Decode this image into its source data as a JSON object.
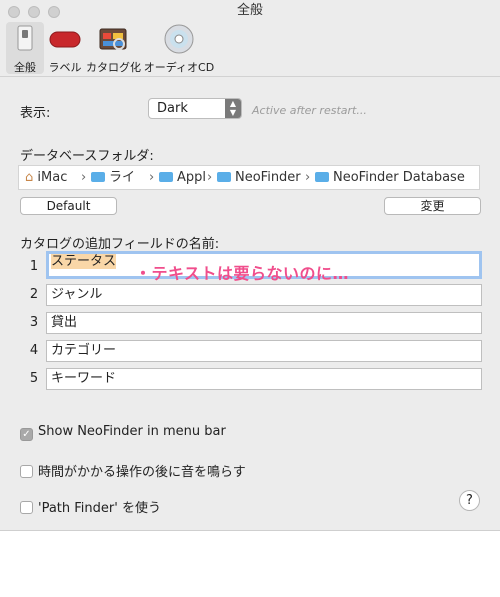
{
  "window": {
    "title": "全般"
  },
  "toolbar": {
    "items": [
      {
        "label": "全般",
        "icon": "general-switch-icon",
        "selected": true
      },
      {
        "label": "ラベル",
        "icon": "label-icon"
      },
      {
        "label": "カタログ化",
        "icon": "catalog-icon"
      },
      {
        "label": "オーディオCD",
        "icon": "audio-cd-icon"
      }
    ]
  },
  "display": {
    "label": "表示:",
    "selected": "Dark",
    "hint": "Active after restart..."
  },
  "database_folder": {
    "label": "データベースフォルダ:",
    "path": [
      "iMac",
      "ライ",
      "Appl",
      "NeoFinder",
      "NeoFinder Database"
    ],
    "default_label": "Default",
    "change_label": "変更"
  },
  "catalog_fields": {
    "label": "カタログの追加フィールドの名前:",
    "fields": [
      {
        "num": "1",
        "value": "ステータス"
      },
      {
        "num": "2",
        "value": "ジャンル"
      },
      {
        "num": "3",
        "value": "貸出"
      },
      {
        "num": "4",
        "value": "カテゴリー"
      },
      {
        "num": "5",
        "value": "キーワード"
      }
    ]
  },
  "annotation": "・テキストは要らないのに…",
  "options": {
    "menu_bar": {
      "label": "Show NeoFinder in menu bar",
      "checked": true
    },
    "sound": {
      "label": "時間がかかる操作の後に音を鳴らす",
      "checked": false
    },
    "path_finder": {
      "label": "'Path Finder' を使う",
      "checked": false
    }
  },
  "help_label": "?",
  "colors": {
    "annotation": "#f04e8c",
    "folder": "#5aaee8",
    "focus_ring": "#9fc4f0"
  }
}
